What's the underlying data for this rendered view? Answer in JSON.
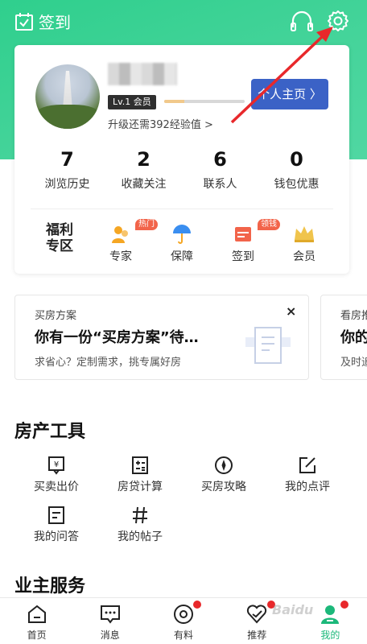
{
  "header": {
    "checkin_label": "签到"
  },
  "profile": {
    "level_badge": "Lv.1 会员",
    "upgrade_text": "升级还需392经验值 >",
    "level_progress": 0.25,
    "homepage_button": "个人主页 〉"
  },
  "stats": [
    {
      "value": "7",
      "label": "浏览历史"
    },
    {
      "value": "2",
      "label": "收藏关注"
    },
    {
      "value": "6",
      "label": "联系人"
    },
    {
      "value": "0",
      "label": "钱包优惠"
    }
  ],
  "quicklinks": {
    "welfare_line1": "福利",
    "welfare_line2": "专区",
    "items": [
      {
        "label": "专家",
        "badge": "热门"
      },
      {
        "label": "保障",
        "badge": ""
      },
      {
        "label": "签到",
        "badge": "领钱"
      },
      {
        "label": "会员",
        "badge": ""
      }
    ]
  },
  "plan_card": {
    "tag": "买房方案",
    "title": "你有一份“买房方案”待…",
    "subtitle": "求省心？定制需求，挑专属好房",
    "close": "×"
  },
  "plan_card2": {
    "tag": "看房推",
    "title": "你的",
    "subtitle": "及时追"
  },
  "property_tools": {
    "title": "房产工具",
    "items": [
      {
        "label": "买卖出价",
        "icon": "price-tag-icon"
      },
      {
        "label": "房贷计算",
        "icon": "calculator-icon"
      },
      {
        "label": "买房攻略",
        "icon": "compass-icon"
      },
      {
        "label": "我的点评",
        "icon": "edit-icon"
      },
      {
        "label": "我的问答",
        "icon": "qa-icon"
      },
      {
        "label": "我的帖子",
        "icon": "hashtag-icon"
      }
    ]
  },
  "owner_services": {
    "title": "业主服务"
  },
  "bottom_nav": [
    {
      "label": "首页",
      "dot": false
    },
    {
      "label": "消息",
      "dot": false
    },
    {
      "label": "有料",
      "dot": true
    },
    {
      "label": "推荐",
      "dot": true
    },
    {
      "label": "我的",
      "dot": true,
      "active": true
    }
  ],
  "colors": {
    "brand_green": "#2fcf8d",
    "button_blue": "#3b62c6",
    "accent_red": "#e8282b",
    "badge_orange": "#f2644a",
    "active_nav": "#1cb87a"
  }
}
